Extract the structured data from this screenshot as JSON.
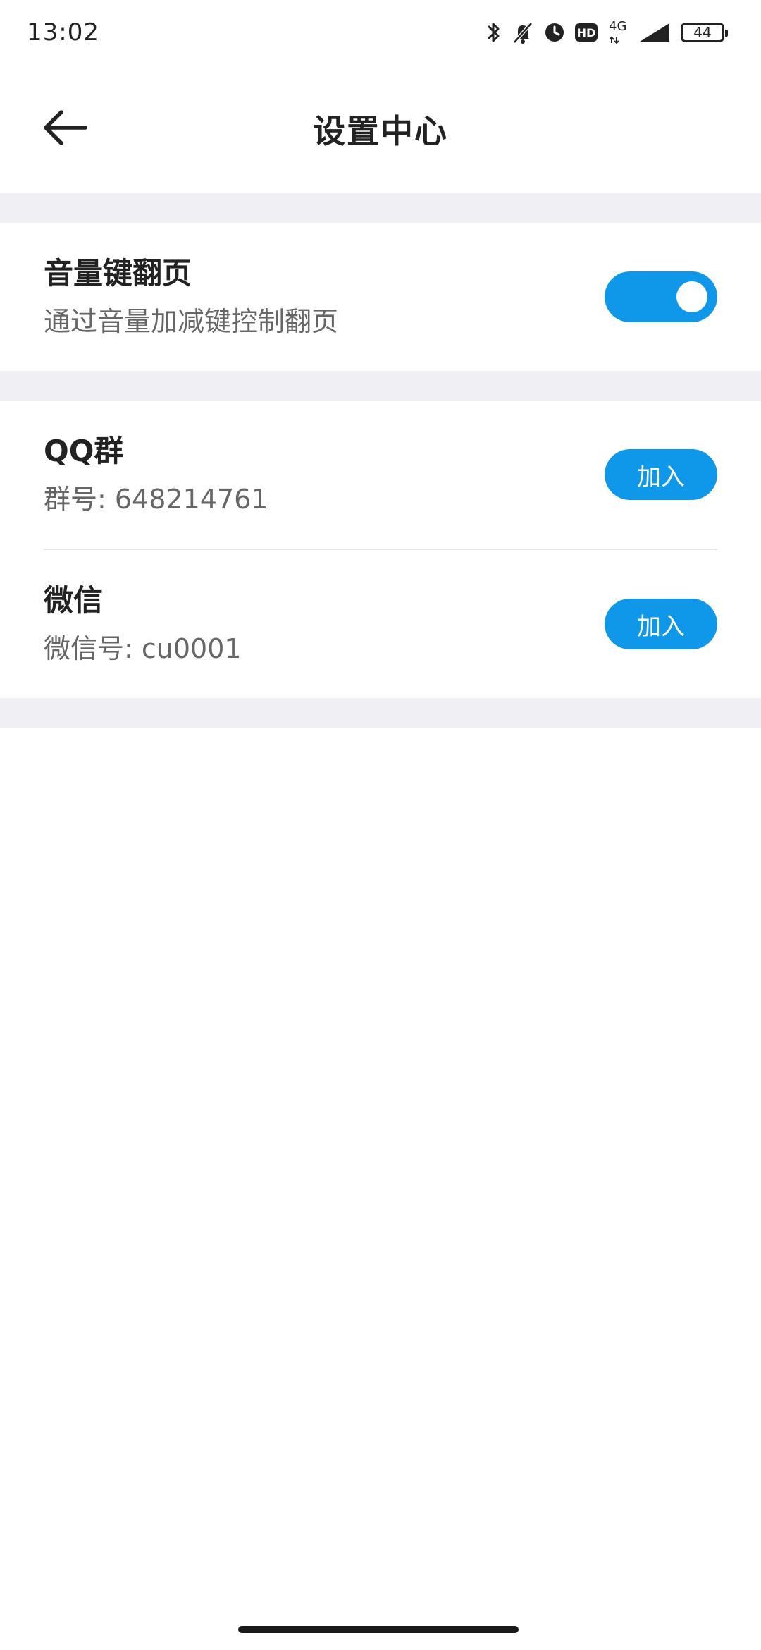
{
  "status_bar": {
    "time": "13:02",
    "network": "4G",
    "battery": "44",
    "hd": "HD",
    "icons": [
      "bluetooth-icon",
      "bell-muted-icon",
      "clock-icon",
      "hd-icon",
      "signal-icon",
      "battery-icon"
    ]
  },
  "header": {
    "title": "设置中心",
    "back_icon": "arrow-left-icon"
  },
  "settings": {
    "volume_page_turn": {
      "title": "音量键翻页",
      "subtitle": "通过音量加减键控制翻页",
      "enabled": true
    }
  },
  "contacts": [
    {
      "title": "QQ群",
      "subtitle": "群号: 648214761",
      "button": "加入"
    },
    {
      "title": "微信",
      "subtitle": "微信号: cu0001",
      "button": "加入"
    }
  ],
  "colors": {
    "accent": "#0f97ea",
    "band": "#f0f0f4",
    "text_primary": "#222222",
    "text_secondary": "#666666"
  }
}
